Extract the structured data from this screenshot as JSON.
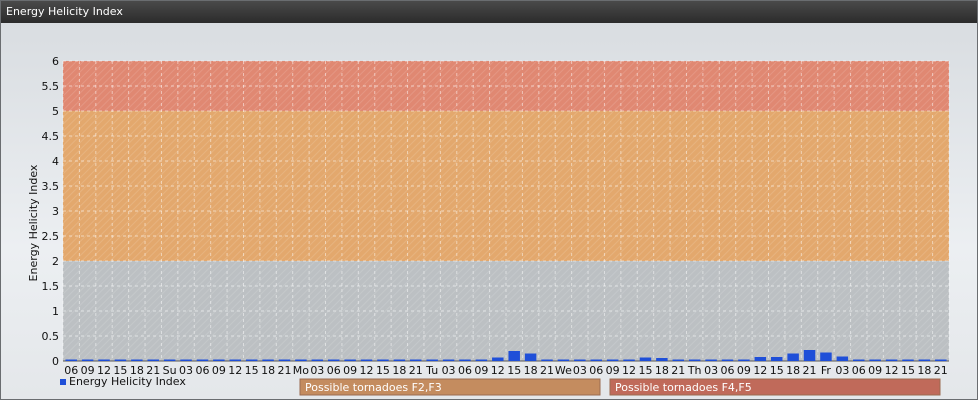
{
  "window": {
    "title": "Energy Helicity Index"
  },
  "chart_data": {
    "type": "bar",
    "title": "",
    "ylabel": "Energy Helicity Index",
    "xlabel": "",
    "ylim": [
      0,
      6
    ],
    "yticks": [
      "0",
      "0.5",
      "1",
      "1.5",
      "2",
      "2.5",
      "3",
      "3.5",
      "4",
      "4.5",
      "5",
      "5.5",
      "6"
    ],
    "grid": true,
    "categories": [
      "06",
      "09",
      "12",
      "15",
      "18",
      "21",
      "Su",
      "03",
      "06",
      "09",
      "12",
      "15",
      "18",
      "21",
      "Mo",
      "03",
      "06",
      "09",
      "12",
      "15",
      "18",
      "21",
      "Tu",
      "03",
      "06",
      "09",
      "12",
      "15",
      "18",
      "21",
      "We",
      "03",
      "06",
      "09",
      "12",
      "15",
      "18",
      "21",
      "Th",
      "03",
      "06",
      "09",
      "12",
      "15",
      "18",
      "21",
      "Fr",
      "03",
      "06",
      "09",
      "12",
      "15",
      "18",
      "21"
    ],
    "series": [
      {
        "name": "Energy Helicity Index",
        "color": "#1f4fd8",
        "values": [
          0.01,
          0.01,
          0.01,
          0.01,
          0.01,
          0.01,
          0.01,
          0.01,
          0.01,
          0.01,
          0.01,
          0.01,
          0.01,
          0.01,
          0.01,
          0.01,
          0.01,
          0.01,
          0.01,
          0.01,
          0.01,
          0.01,
          0.01,
          0.01,
          0.01,
          0.01,
          0.07,
          0.2,
          0.15,
          0.01,
          0.01,
          0.01,
          0.01,
          0.01,
          0.01,
          0.07,
          0.06,
          0.02,
          0.01,
          0.01,
          0.01,
          0.01,
          0.08,
          0.08,
          0.15,
          0.22,
          0.17,
          0.09,
          0.01,
          0.01,
          0.01,
          0.01,
          0.01,
          0.01
        ]
      }
    ],
    "bands": [
      {
        "from": 0,
        "to": 2,
        "color": "#bcc0c3"
      },
      {
        "from": 2,
        "to": 5,
        "color": "#e3a86d"
      },
      {
        "from": 5,
        "to": 6,
        "color": "#e08872"
      }
    ],
    "legend": {
      "placement": "bottom-left",
      "label": "Energy Helicity Index",
      "color": "#1f4fd8"
    },
    "band_legend": [
      {
        "label": "Possible tornadoes F2,F3",
        "color": "#c48c5f"
      },
      {
        "label": "Possible tornadoes F4,F5",
        "color": "#c06a5a"
      }
    ]
  }
}
